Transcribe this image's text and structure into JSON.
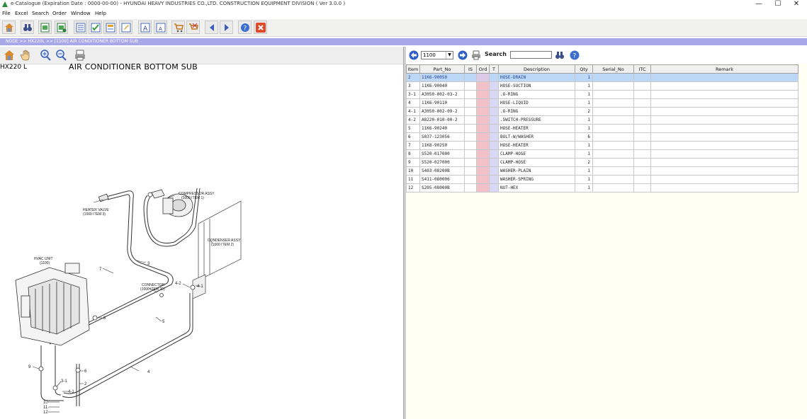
{
  "window": {
    "title": "e-Catalogue (Expiration Date : 0000-00-00)  -  HYUNDAI HEAVY INDUSTRIES CO.,LTD. CONSTRUCTION EQUIPMENT DIVISION ( Ver 3.0.0 )",
    "minimize": "—",
    "maximize": "☐",
    "close": "✕"
  },
  "menu": [
    "File",
    "Excel",
    "Search",
    "Order",
    "Window",
    "Help"
  ],
  "breadcrumb": "NODE >> HX220L >> [1100] AIR CONDITIONER BOTTOM SUB",
  "drawing": {
    "model": "HX220 L",
    "title": "AIR CONDITIONER BOTTOM SUB",
    "labels": {
      "compressor": "COMPRESSOR ASSY",
      "compressor_ref": "(1000 ITEM 1)",
      "heater_valve": "HEATER VALVE",
      "heater_ref": "(1000 ITEM 3)",
      "condenser": "CONDENSER ASSY",
      "condenser_ref": "(1000 ITEM 2)",
      "hvac": "HVAC UNIT",
      "hvac_ref": "(1100)",
      "connector": "CONNECTOR",
      "connector_ref": "(1000 ITEM 20)"
    },
    "callouts": [
      "7",
      "3",
      "4-2",
      "4-1",
      "8",
      "5",
      "4",
      "9",
      "6",
      "3-1",
      "4-1",
      "2",
      "10",
      "11",
      "12"
    ]
  },
  "parts_panel": {
    "selected_group": "1100",
    "search_label": "Search",
    "search_value": "",
    "columns": [
      "Item",
      "Part_No",
      "IS",
      "Ord",
      "T",
      "Description",
      "Qty",
      "Serial_No",
      "ITC",
      "Remark"
    ],
    "rows": [
      {
        "item": "2",
        "part_no": "11K6-90050",
        "description": "HOSE-DRAIN",
        "qty": "1",
        "selected": true
      },
      {
        "item": "3",
        "part_no": "11K6-90040",
        "description": "HOSE-SUCTION",
        "qty": "1"
      },
      {
        "item": "3-1",
        "part_no": "A3050-002-03-2",
        "description": ".O-RING",
        "qty": "1"
      },
      {
        "item": "4",
        "part_no": "11K6-90110",
        "description": "HOSE-LIQUID",
        "qty": "1"
      },
      {
        "item": "4-1",
        "part_no": "A3050-002-09-2",
        "description": ".O-RING",
        "qty": "2"
      },
      {
        "item": "4-2",
        "part_no": "A8220-010-00-2",
        "description": ".SWITCH-PRESSURE",
        "qty": "1"
      },
      {
        "item": "5",
        "part_no": "11K6-90240",
        "description": "HOSE-HEATER",
        "qty": "1"
      },
      {
        "item": "6",
        "part_no": "S037-123056",
        "description": "BOLT-W/WASHER",
        "qty": "6"
      },
      {
        "item": "7",
        "part_no": "11K8-90250",
        "description": "HOSE-HEATER",
        "qty": "1"
      },
      {
        "item": "8",
        "part_no": "S520-017000",
        "description": "CLAMP-HOSE",
        "qty": "1"
      },
      {
        "item": "9",
        "part_no": "S520-027000",
        "description": "CLAMP-HOSE",
        "qty": "2"
      },
      {
        "item": "10",
        "part_no": "S403-08200B",
        "description": "WASHER-PLAIN",
        "qty": "1"
      },
      {
        "item": "11",
        "part_no": "S411-080006",
        "description": "WASHER-SPRING",
        "qty": "1"
      },
      {
        "item": "12",
        "part_no": "S205-08000B",
        "description": "NUT-HEX",
        "qty": "1"
      }
    ]
  },
  "colors": {
    "breadcrumb_bg": "#a8a8e8",
    "selected_row": "#bcd8f6",
    "ord_column": "#f2c2c8",
    "t_column": "#d8d8f4",
    "panel_bg": "#fffff4"
  }
}
